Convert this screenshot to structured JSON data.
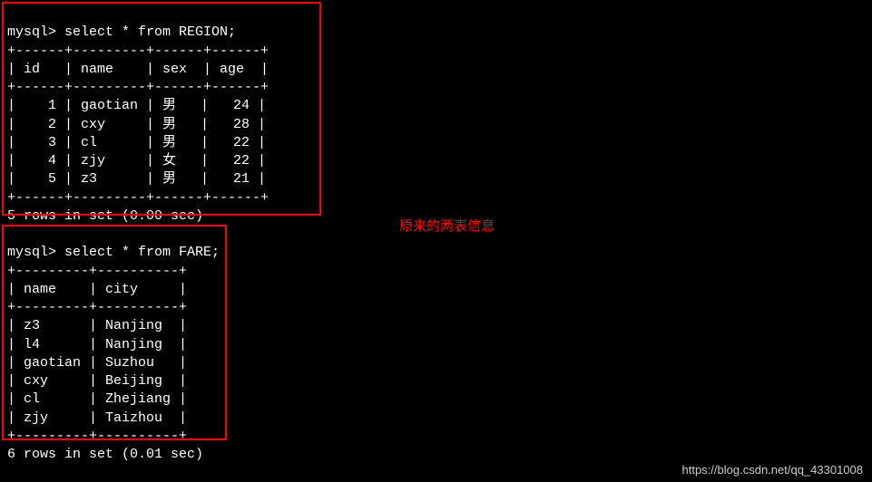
{
  "query1": {
    "prompt": "mysql> ",
    "sql": "select * from REGION;",
    "divider": "+------+---------+------+------+",
    "header": "| id   | name    | sex  | age  |",
    "rows": [
      "|    1 | gaotian | 男   |   24 |",
      "|    2 | cxy     | 男   |   28 |",
      "|    3 | cl      | 男   |   22 |",
      "|    4 | zjy     | 女   |   22 |",
      "|    5 | z3      | 男   |   21 |"
    ],
    "footer": "5 rows in set (0.00 sec)"
  },
  "query2": {
    "prompt": "mysql> ",
    "sql": "select * from FARE;",
    "divider": "+---------+----------+",
    "header": "| name    | city     |",
    "rows": [
      "| z3      | Nanjing  |",
      "| l4      | Nanjing  |",
      "| gaotian | Suzhou   |",
      "| cxy     | Beijing  |",
      "| cl      | Zhejiang |",
      "| zjy     | Taizhou  |"
    ],
    "footer": "6 rows in set (0.01 sec)"
  },
  "annotation_text": "原来的两表信息",
  "watermark_text": "https://blog.csdn.net/qq_43301008"
}
